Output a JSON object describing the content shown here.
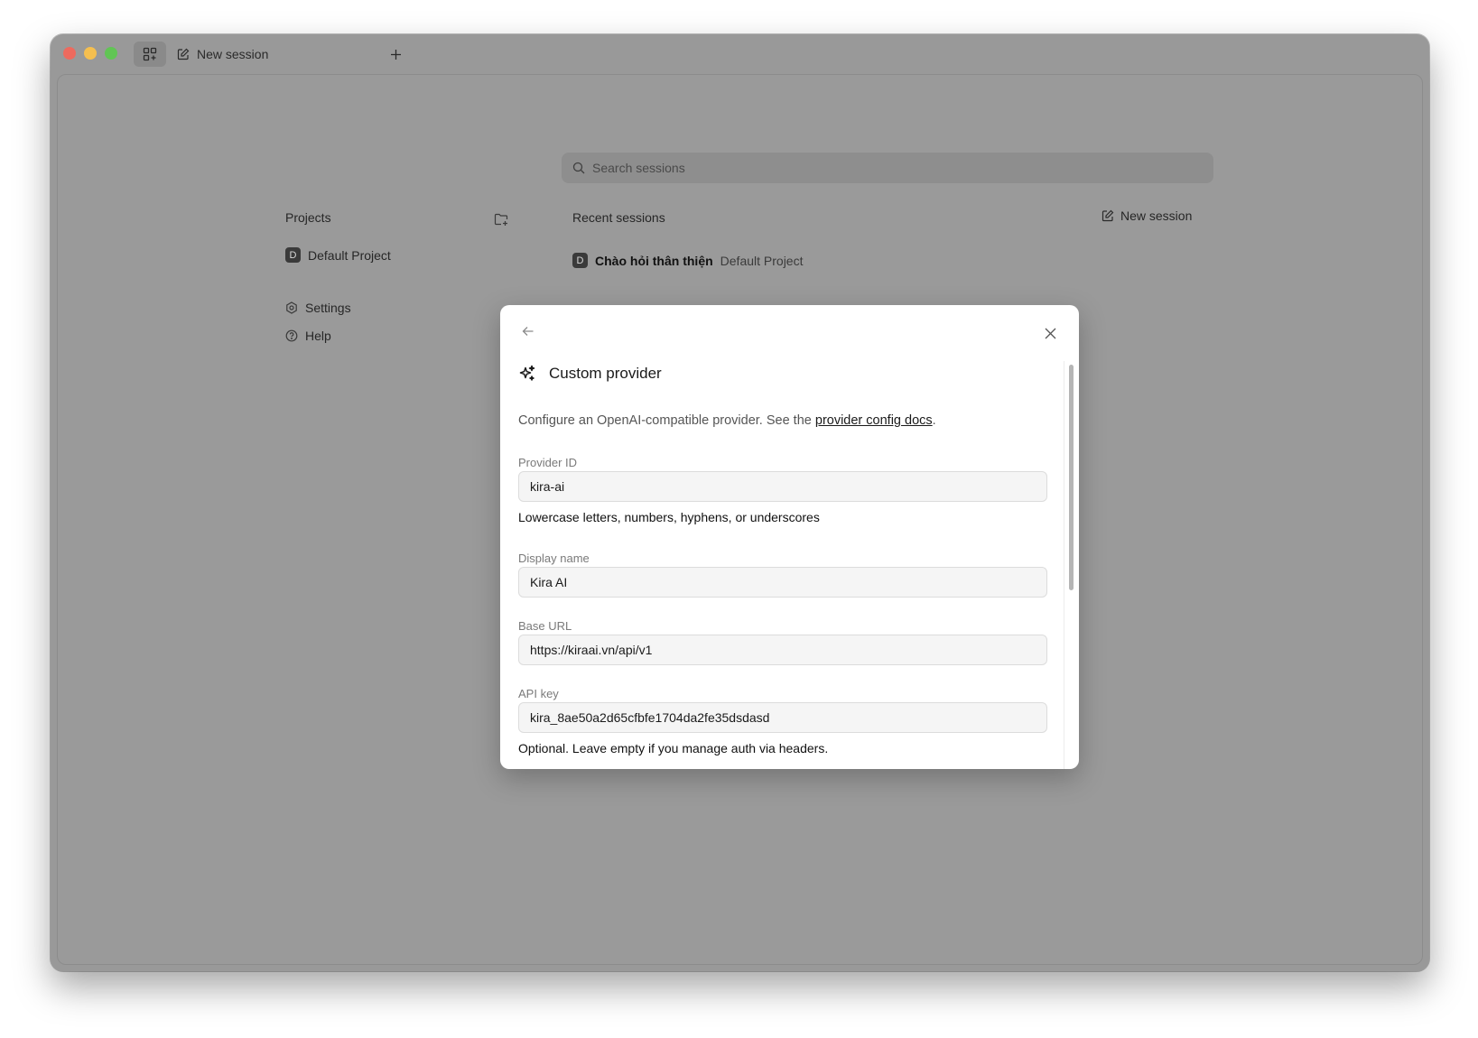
{
  "titlebar": {
    "tab_label": "New session"
  },
  "search": {
    "placeholder": "Search sessions"
  },
  "sidebar": {
    "projects_title": "Projects",
    "projects": [
      {
        "badge": "D",
        "label": "Default Project"
      }
    ],
    "nav": [
      {
        "label": "Settings",
        "icon": "gear-icon"
      },
      {
        "label": "Help",
        "icon": "help-icon"
      }
    ]
  },
  "sessions": {
    "title": "Recent sessions",
    "new_session_label": "New session",
    "items": [
      {
        "badge": "D",
        "title": "Chào hỏi thân thiện",
        "project": "Default Project"
      }
    ]
  },
  "modal": {
    "title": "Custom provider",
    "description_prefix": "Configure an OpenAI-compatible provider. See the ",
    "description_link": "provider config docs",
    "description_suffix": ".",
    "fields": [
      {
        "label": "Provider ID",
        "value": "kira-ai",
        "hint": "Lowercase letters, numbers, hyphens, or underscores"
      },
      {
        "label": "Display name",
        "value": "Kira AI",
        "hint": ""
      },
      {
        "label": "Base URL",
        "value": "https://kiraai.vn/api/v1",
        "hint": ""
      },
      {
        "label": "API key",
        "value": "kira_8ae50a2d65cfbfe1704da2fe35dsdasd",
        "hint": "Optional. Leave empty if you manage auth via headers."
      }
    ]
  },
  "colors": {
    "overlay": "#999999",
    "modal_bg": "#ffffff",
    "input_bg": "#f5f5f5"
  }
}
